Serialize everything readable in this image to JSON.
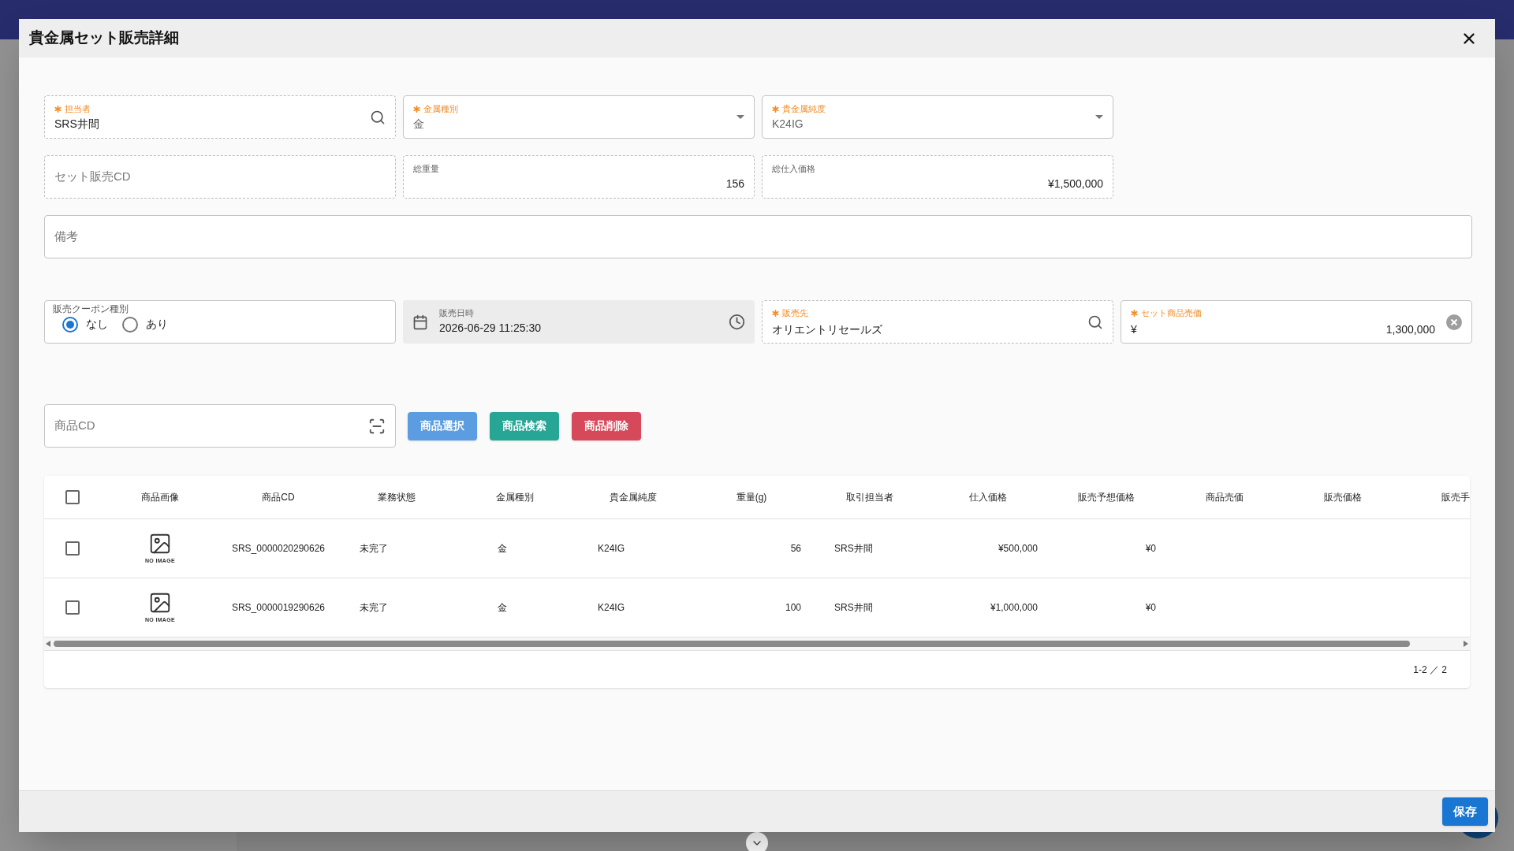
{
  "dialog": {
    "title": "貴金属セット販売詳細"
  },
  "row1": [
    {
      "kind": "search",
      "label": "担当者",
      "required": true,
      "readonly": true,
      "value": "SRS井間"
    },
    {
      "kind": "select",
      "label": "金属種別",
      "required": true,
      "readonly": false,
      "value": "金"
    },
    {
      "kind": "select",
      "label": "貴金属純度",
      "required": true,
      "readonly": false,
      "value": "K24IG"
    }
  ],
  "row2": [
    {
      "kind": "placeholder",
      "readonly": true,
      "placeholder": "セット販売CD"
    },
    {
      "kind": "number",
      "label": "総重量",
      "required": false,
      "readonly": true,
      "value": "156"
    },
    {
      "kind": "number",
      "label": "総仕入価格",
      "required": false,
      "readonly": true,
      "value": "¥1,500,000"
    }
  ],
  "remarks": {
    "placeholder": "備考"
  },
  "coupon": {
    "label": "販売クーポン種別",
    "options": [
      {
        "label": "なし",
        "selected": true
      },
      {
        "label": "あり",
        "selected": false
      }
    ]
  },
  "sale_date": {
    "label": "販売日時",
    "value": "2026-06-29 11:25:30"
  },
  "customer": {
    "label": "販売先",
    "required": true,
    "readonly": true,
    "value": "オリエントリセールズ"
  },
  "set_price": {
    "label": "セット商品売価",
    "required": true,
    "prefix": "¥",
    "value": "1,300,000"
  },
  "product_cd": {
    "placeholder": "商品CD"
  },
  "actions": [
    {
      "label": "商品選択",
      "color": "#5b9de0"
    },
    {
      "label": "商品検索",
      "color": "#27a595"
    },
    {
      "label": "商品削除",
      "color": "#d6495a"
    }
  ],
  "table": {
    "all_checked": false,
    "columns": [
      "商品画像",
      "商品CD",
      "業務状態",
      "金属種別",
      "貴金属純度",
      "重量(g)",
      "取引担当者",
      "仕入価格",
      "販売予想価格",
      "商品売価",
      "販売価格",
      "販売手"
    ],
    "rows": [
      {
        "checked": false,
        "cells": [
          "NO IMAGE",
          "SRS_0000020290626",
          "未完了",
          "金",
          "K24IG",
          "56",
          "SRS井間",
          "¥500,000",
          "¥0"
        ]
      },
      {
        "checked": false,
        "cells": [
          "NO IMAGE",
          "SRS_0000019290626",
          "未完了",
          "金",
          "K24IG",
          "100",
          "SRS井間",
          "¥1,000,000",
          "¥0"
        ]
      }
    ],
    "pagination": "1-2 ／ 2"
  },
  "save_button": "保存"
}
